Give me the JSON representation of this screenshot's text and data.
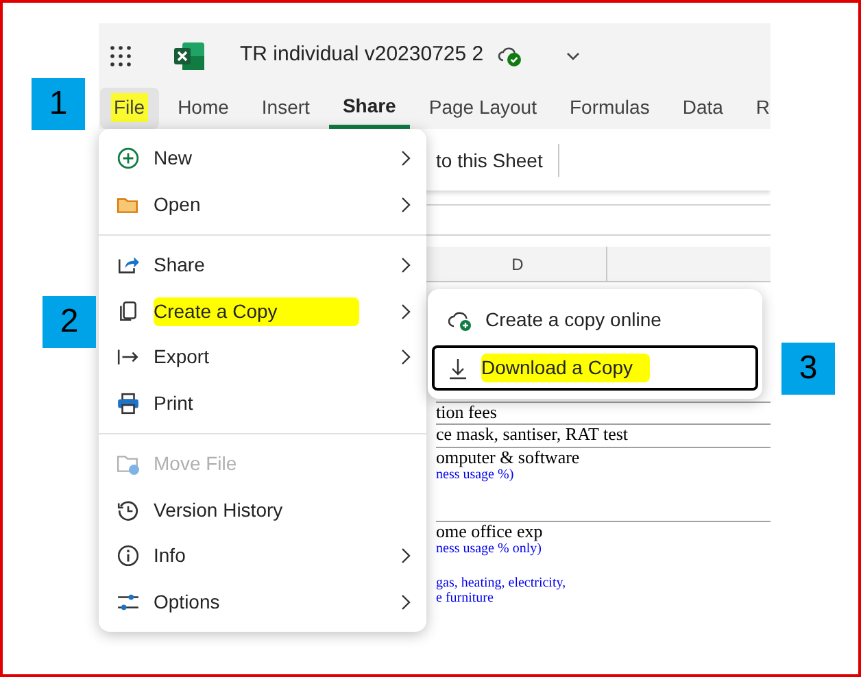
{
  "app": {
    "title": "TR individual v20230725 2"
  },
  "tabs": [
    {
      "label": "File",
      "selected": false,
      "open": true,
      "highlighted": true
    },
    {
      "label": "Home",
      "selected": false,
      "open": false,
      "highlighted": false
    },
    {
      "label": "Insert",
      "selected": false,
      "open": false,
      "highlighted": false
    },
    {
      "label": "Share",
      "selected": true,
      "open": false,
      "highlighted": false
    },
    {
      "label": "Page Layout",
      "selected": false,
      "open": false,
      "highlighted": false
    },
    {
      "label": "Formulas",
      "selected": false,
      "open": false,
      "highlighted": false
    },
    {
      "label": "Data",
      "selected": false,
      "open": false,
      "highlighted": false
    },
    {
      "label": "R",
      "selected": false,
      "open": false,
      "highlighted": false
    }
  ],
  "toolbar": {
    "text": "to this Sheet"
  },
  "sheet": {
    "column_header": "D",
    "rows": [
      {
        "lines": [
          {
            "text": "tion fees",
            "kind": "label"
          }
        ]
      },
      {
        "lines": [
          {
            "text": "ce mask, santiser, RAT test",
            "kind": "label"
          }
        ]
      },
      {
        "lines": [
          {
            "text": "omputer & software",
            "kind": "label"
          },
          {
            "text": "ness usage %)",
            "kind": "note"
          }
        ]
      },
      {
        "lines": [
          {
            "text": "ome office exp",
            "kind": "label"
          },
          {
            "text": "ness usage % only)",
            "kind": "note"
          },
          {
            "text": "gas, heating, electricity,",
            "kind": "note"
          },
          {
            "text": "e furniture",
            "kind": "note"
          }
        ]
      }
    ]
  },
  "file_menu": {
    "sections": [
      [
        {
          "label": "New",
          "submenu": true,
          "disabled": false,
          "highlighted": false
        },
        {
          "label": "Open",
          "submenu": true,
          "disabled": false,
          "highlighted": false
        }
      ],
      [
        {
          "label": "Share",
          "submenu": true,
          "disabled": false,
          "highlighted": false
        },
        {
          "label": "Create a Copy",
          "submenu": true,
          "disabled": false,
          "highlighted": true
        },
        {
          "label": "Export",
          "submenu": true,
          "disabled": false,
          "highlighted": false
        },
        {
          "label": "Print",
          "submenu": false,
          "disabled": false,
          "highlighted": false
        }
      ],
      [
        {
          "label": "Move File",
          "submenu": false,
          "disabled": true,
          "highlighted": false
        },
        {
          "label": "Version History",
          "submenu": false,
          "disabled": false,
          "highlighted": false
        },
        {
          "label": "Info",
          "submenu": true,
          "disabled": false,
          "highlighted": false
        },
        {
          "label": "Options",
          "submenu": true,
          "disabled": false,
          "highlighted": false
        }
      ]
    ]
  },
  "copy_submenu": {
    "items": [
      {
        "label": "Create a copy online",
        "focused": false,
        "highlighted": false
      },
      {
        "label": "Download a Copy",
        "focused": true,
        "highlighted": true
      }
    ]
  },
  "callouts": [
    {
      "label": "1"
    },
    {
      "label": "2"
    },
    {
      "label": "3"
    }
  ]
}
